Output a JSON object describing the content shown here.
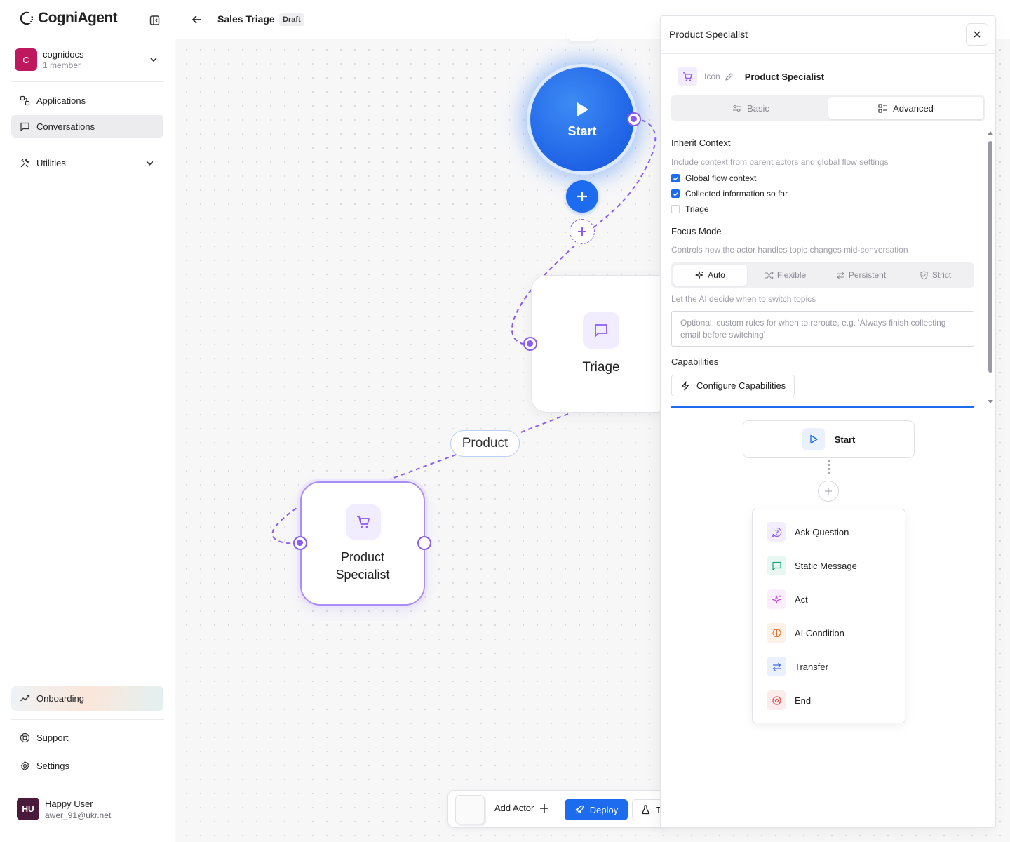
{
  "app": {
    "name": "CogniAgent"
  },
  "workspace": {
    "name": "cognidocs",
    "initial": "C",
    "members": "1 member"
  },
  "nav": {
    "applications": "Applications",
    "conversations": "Conversations",
    "utilities": "Utilities"
  },
  "bottom_nav": {
    "onboarding": "Onboarding",
    "support": "Support",
    "settings": "Settings"
  },
  "user": {
    "initials": "HU",
    "name": "Happy User",
    "email": "awer_91@ukr.net"
  },
  "topbar": {
    "title": "Sales Triage",
    "badge": "Draft"
  },
  "canvas": {
    "start_label": "Start",
    "triage_label": "Triage",
    "edge_label": "Product",
    "product_label_line1": "Product",
    "product_label_line2": "Specialist"
  },
  "toolbar": {
    "add_actor": "Add Actor",
    "deploy": "Deploy",
    "test": "T"
  },
  "panel": {
    "title": "Product Specialist",
    "icon_label": "Icon",
    "actor_name": "Product Specialist",
    "tabs": {
      "basic": "Basic",
      "advanced": "Advanced"
    },
    "inherit": {
      "title": "Inherit Context",
      "desc": "Include context from parent actors and global flow settings",
      "options": [
        {
          "label": "Global flow context",
          "checked": true
        },
        {
          "label": "Collected information so far",
          "checked": true
        },
        {
          "label": "Triage",
          "checked": false
        }
      ]
    },
    "focus": {
      "title": "Focus Mode",
      "desc": "Controls how the actor handles topic changes mid-conversation",
      "modes": [
        "Auto",
        "Flexible",
        "Persistent",
        "Strict"
      ],
      "selected": "Auto",
      "hint": "Let the AI decide when to switch topics",
      "placeholder": "Optional: custom rules for when to reroute, e.g. 'Always finish collecting email before switching'"
    },
    "capabilities": {
      "title": "Capabilities",
      "button": "Configure Capabilities"
    },
    "flow": {
      "start": "Start",
      "menu": [
        "Ask Question",
        "Static Message",
        "Act",
        "AI Condition",
        "Transfer",
        "End"
      ]
    }
  },
  "colors": {
    "accent": "#1d6cf0",
    "violet": "#8a5cf5",
    "workspace_avatar": "#c0185f"
  }
}
